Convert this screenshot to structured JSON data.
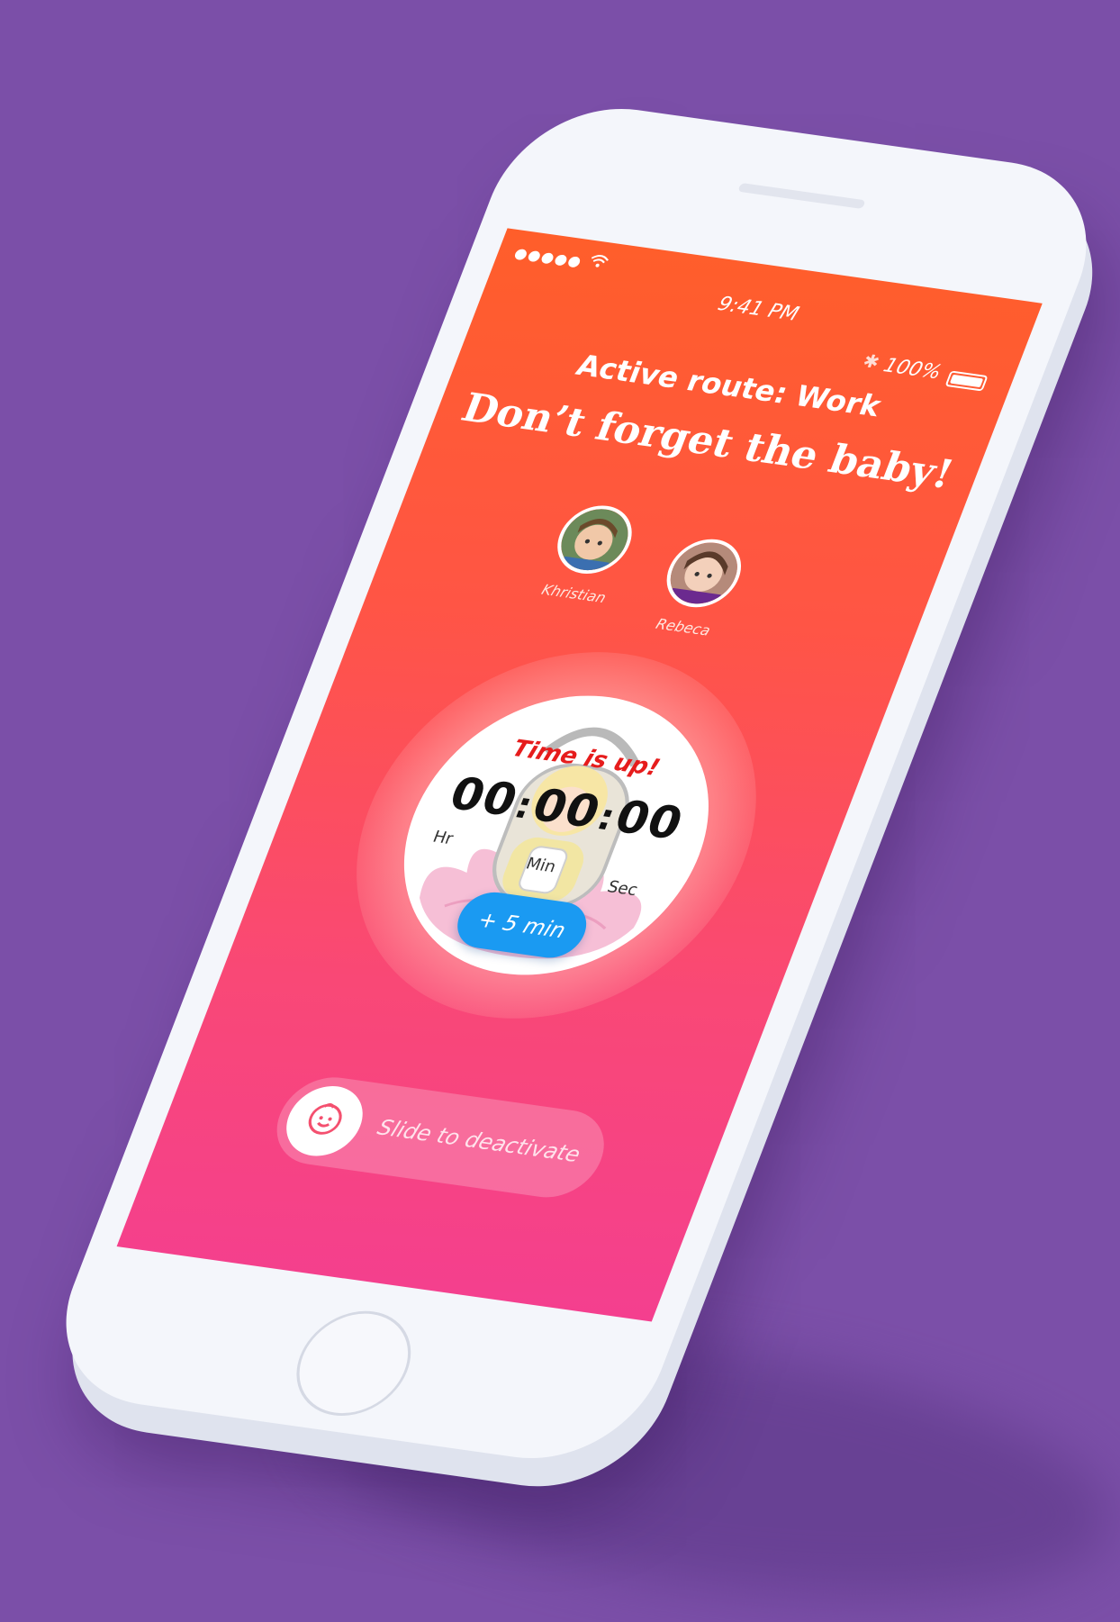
{
  "status_bar": {
    "signal": "●●●●●",
    "wifi_icon": "wifi-icon",
    "time": "9:41 PM",
    "bluetooth_icon": "bluetooth-icon",
    "battery": "100%"
  },
  "header": {
    "route": "Active route: Work",
    "headline": "Don’t forget the baby!"
  },
  "children": [
    {
      "name": "Khristian"
    },
    {
      "name": "Rebeca"
    }
  ],
  "timer": {
    "status": "Time is up!",
    "hours": "00",
    "minutes": "00",
    "seconds": "00",
    "separator": ":",
    "hours_label": "Hr",
    "minutes_label": "Min",
    "seconds_label": "Sec",
    "extend_button": "+ 5 min"
  },
  "slider": {
    "label": "Slide to deactivate",
    "knob_icon": "baby-face-icon"
  },
  "colors": {
    "background": "#7b4fa8",
    "gradient_top": "#ff5e2a",
    "gradient_bottom": "#f43f8f",
    "button_blue": "#1a9af2",
    "alert_red": "#e61c1c"
  }
}
